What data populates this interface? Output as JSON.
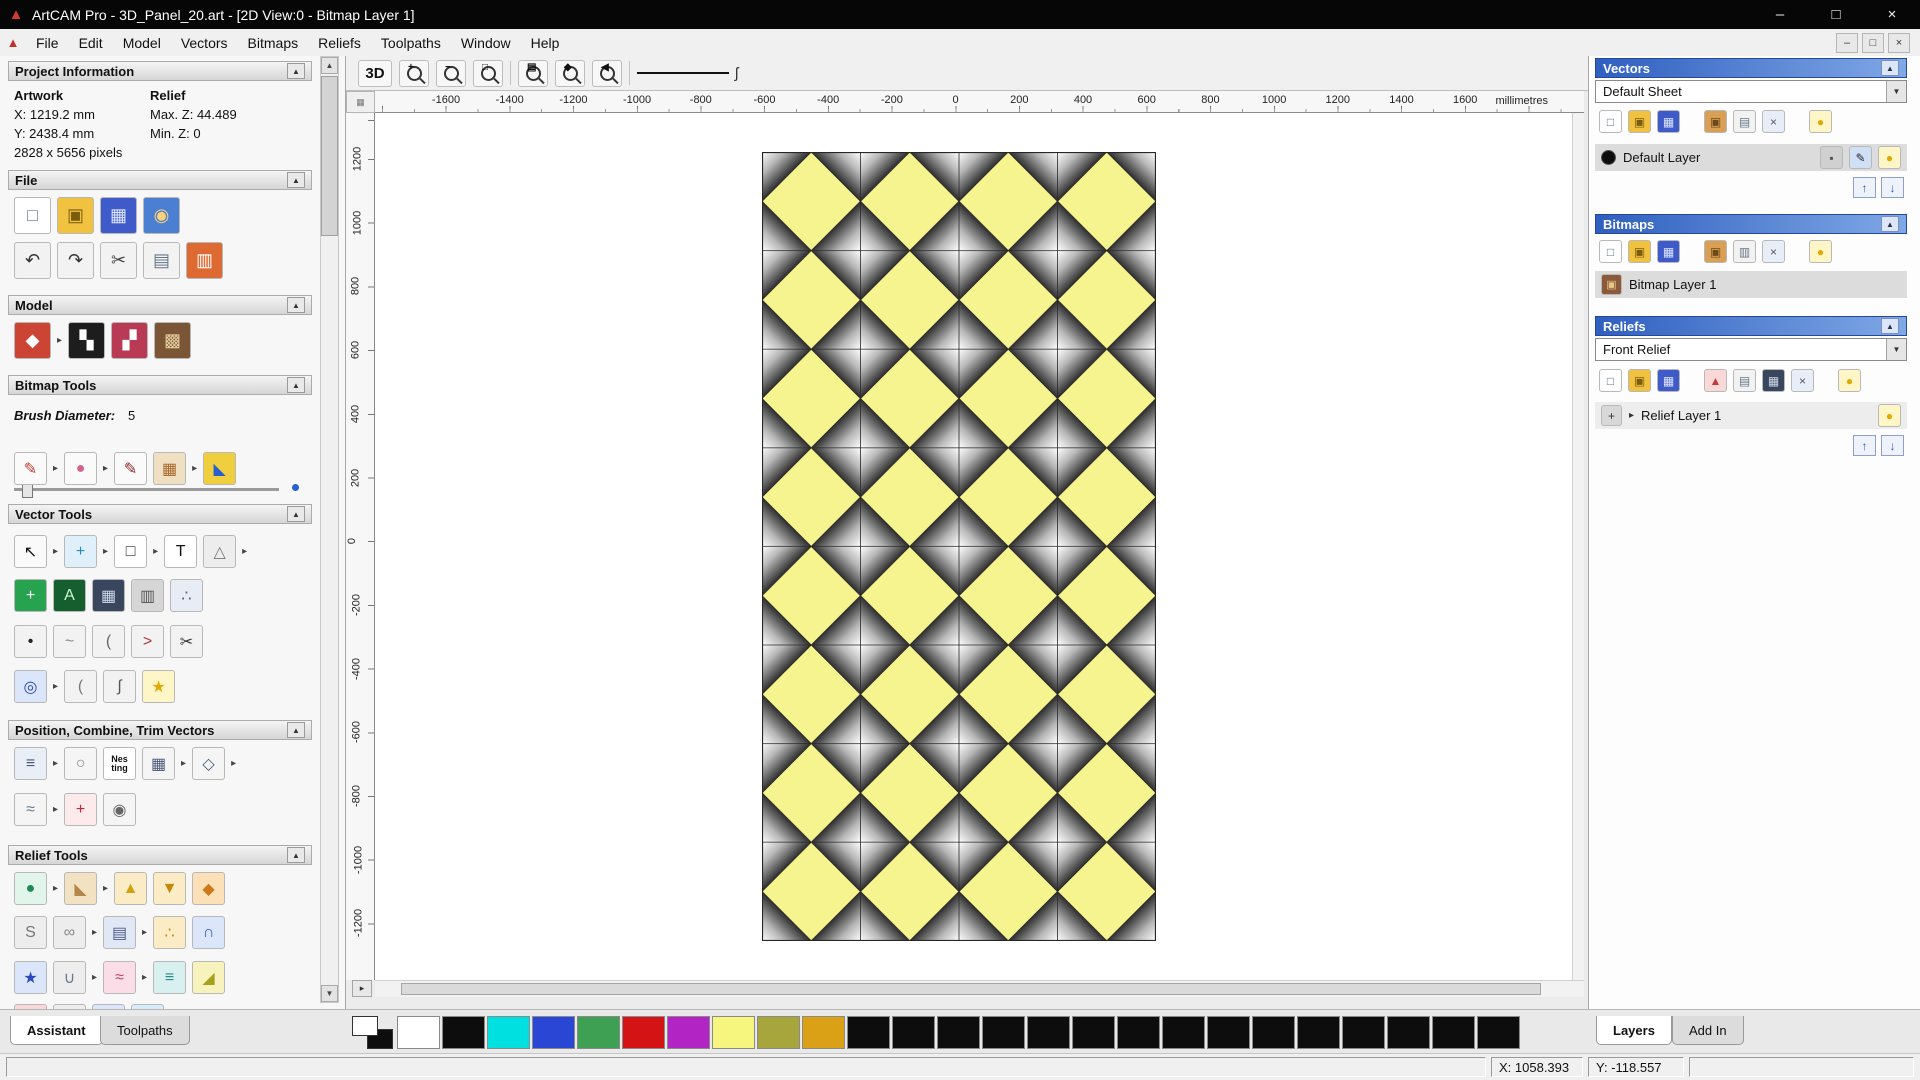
{
  "window": {
    "title": "ArtCAM Pro - 3D_Panel_20.art - [2D View:0 - Bitmap Layer 1]",
    "minimize": "–",
    "maximize": "□",
    "close": "×"
  },
  "menu": {
    "items": [
      "File",
      "Edit",
      "Model",
      "Vectors",
      "Bitmaps",
      "Reliefs",
      "Toolpaths",
      "Window",
      "Help"
    ],
    "child_controls": [
      "–",
      "□",
      "×"
    ]
  },
  "left_panel": {
    "project_info": {
      "header": "Project Information",
      "artwork_label": "Artwork",
      "relief_label": "Relief",
      "artwork_x": "X: 1219.2 mm",
      "artwork_y": "Y: 2438.4 mm",
      "artwork_pixels": "2828 x 5656 pixels",
      "relief_max": "Max. Z: 44.489",
      "relief_min": "Min. Z: 0"
    },
    "file": {
      "header": "File",
      "row1": [
        {
          "n": "new-model",
          "g": "□",
          "bg": "#ffffff",
          "fg": "#667788"
        },
        {
          "n": "open-model",
          "g": "▣",
          "bg": "#f1c240",
          "fg": "#7a5c10"
        },
        {
          "n": "save-model",
          "g": "▦",
          "bg": "#3f5bc9",
          "fg": "#dfe6ff"
        },
        {
          "n": "model-preview",
          "g": "◉",
          "bg": "#4a7fd1",
          "fg": "#ffd27a"
        }
      ],
      "row2": [
        {
          "n": "undo",
          "g": "↶",
          "bg": "#f2f2f2",
          "fg": "#333333"
        },
        {
          "n": "redo",
          "g": "↷",
          "bg": "#f2f2f2",
          "fg": "#333333"
        },
        {
          "n": "cut",
          "g": "✂",
          "bg": "#f2f2f2",
          "fg": "#444444"
        },
        {
          "n": "copy",
          "g": "▤",
          "bg": "#f2f2f2",
          "fg": "#667788"
        },
        {
          "n": "paste",
          "g": "▥",
          "bg": "#dd6a33",
          "fg": "#ffffff"
        }
      ]
    },
    "model": {
      "header": "Model",
      "row": [
        {
          "n": "set-model-size",
          "g": "◆",
          "bg": "#cc4433",
          "fg": "#ffffff"
        },
        {
          "t": "fly"
        },
        {
          "n": "invert-model",
          "g": "▚",
          "bg": "#1d1d1d",
          "fg": "#ffffff"
        },
        {
          "n": "adjust-model",
          "g": "▞",
          "bg": "#b83a55",
          "fg": "#ffffff"
        },
        {
          "n": "load-bitmap",
          "g": "▩",
          "bg": "#7a5636",
          "fg": "#e6cf9e"
        }
      ]
    },
    "bitmap_tools": {
      "header": "Bitmap Tools",
      "brush_label": "Brush Diameter:",
      "brush_value": "5",
      "row": [
        {
          "n": "paint",
          "g": "✎",
          "bg": "#fafafa",
          "fg": "#c03a2b"
        },
        {
          "t": "fly"
        },
        {
          "n": "paint-selective",
          "g": "●",
          "bg": "#fafafa",
          "fg": "#d4628f"
        },
        {
          "t": "fly"
        },
        {
          "n": "draw",
          "g": "✎",
          "bg": "#fafafa",
          "fg": "#8a1f1f"
        },
        {
          "n": "colour-reduce",
          "g": "▦",
          "bg": "#efe0c2",
          "fg": "#a8652a"
        },
        {
          "t": "fly"
        },
        {
          "n": "flood-fill",
          "g": "◣",
          "bg": "#f0cf3e",
          "fg": "#2a5fd1"
        }
      ]
    },
    "vector_tools": {
      "header": "Vector Tools",
      "row1": [
        {
          "n": "select-vectors",
          "g": "↖",
          "bg": "#fafafa",
          "fg": "#111111"
        },
        {
          "t": "fly"
        },
        {
          "n": "transform-vectors",
          "g": "+",
          "bg": "#dff0fa",
          "fg": "#2589bd"
        },
        {
          "t": "fly"
        },
        {
          "n": "create-rectangle",
          "g": "□",
          "bg": "#ffffff",
          "fg": "#333333"
        },
        {
          "t": "fly"
        },
        {
          "n": "create-text",
          "g": "T",
          "bg": "#ffffff",
          "fg": "#111111"
        },
        {
          "n": "measure-tool",
          "g": "△",
          "bg": "#ededed",
          "fg": "#777777"
        },
        {
          "t": "fly"
        }
      ],
      "row2": [
        {
          "n": "snap-to-grid",
          "g": "+",
          "bg": "#27a24f",
          "fg": "#ffffff"
        },
        {
          "n": "text-on-curve",
          "g": "A",
          "bg": "#155e2e",
          "fg": "#c8f5d2"
        },
        {
          "n": "grid-settings",
          "g": "▦",
          "bg": "#39465e",
          "fg": "#cdd8ea"
        },
        {
          "n": "guidelines",
          "g": "▥",
          "bg": "#d6d6d6",
          "fg": "#555555"
        },
        {
          "n": "paste-along-curve",
          "g": "∴",
          "bg": "#e8ecf5",
          "fg": "#56607a"
        }
      ],
      "row3": [
        {
          "n": "node-editing",
          "g": "•",
          "bg": "#f2f2f2",
          "fg": "#222222"
        },
        {
          "n": "create-polyline",
          "g": "~",
          "bg": "#f2f2f2",
          "fg": "#888888"
        },
        {
          "n": "fit-arc",
          "g": "(",
          "bg": "#f2f2f2",
          "fg": "#666666"
        },
        {
          "n": "freehand-draw",
          "g": ">",
          "bg": "#f2f2f2",
          "fg": "#b03a3a"
        },
        {
          "n": "trim-vectors",
          "g": "✂",
          "bg": "#f2f2f2",
          "fg": "#333333"
        }
      ],
      "row4": [
        {
          "n": "offset-vectors",
          "g": "◎",
          "bg": "#dbe6fa",
          "fg": "#2a49bd"
        },
        {
          "t": "fly"
        },
        {
          "n": "fillet-corners",
          "g": "(",
          "bg": "#f2f2f2",
          "fg": "#777777"
        },
        {
          "n": "create-section",
          "g": "∫",
          "bg": "#f2f2f2",
          "fg": "#555555"
        },
        {
          "n": "create-star",
          "g": "★",
          "bg": "#fff6c8",
          "fg": "#e0a800"
        }
      ]
    },
    "position_tools": {
      "header": "Position, Combine, Trim Vectors",
      "row1": [
        {
          "n": "align-vectors",
          "g": "≡",
          "bg": "#e9eff7",
          "fg": "#4a5a7a"
        },
        {
          "t": "fly"
        },
        {
          "n": "circular-copy",
          "g": "○",
          "bg": "#f5f5f5",
          "fg": "#888888"
        },
        {
          "n": "nesting",
          "g": "Nes ting",
          "bg": "#ffffff",
          "fg": "#111111"
        },
        {
          "n": "block-copy",
          "g": "▦",
          "bg": "#f5f5f5",
          "fg": "#4a5a7a"
        },
        {
          "t": "fly"
        },
        {
          "n": "copy-rotate",
          "g": "◇",
          "bg": "#f5f5f5",
          "fg": "#4a5a7a"
        },
        {
          "t": "fly"
        }
      ],
      "row2": [
        {
          "n": "mirror-vectors",
          "g": "≈",
          "bg": "#f5f5f5",
          "fg": "#6a7a8a"
        },
        {
          "t": "fly"
        },
        {
          "n": "vector-doctor",
          "g": "+",
          "bg": "#fdeaea",
          "fg": "#c22a3a"
        },
        {
          "n": "create-spiral",
          "g": "◉",
          "bg": "#f5f5f5",
          "fg": "#666666"
        }
      ]
    },
    "relief_tools": {
      "header": "Relief Tools",
      "row1": [
        {
          "n": "shape-editor",
          "g": "●",
          "bg": "#e2f5ea",
          "fg": "#1f8a55"
        },
        {
          "t": "fly"
        },
        {
          "n": "smooth-relief",
          "g": "◣",
          "bg": "#f2e2c2",
          "fg": "#b5854a"
        },
        {
          "t": "fly"
        },
        {
          "n": "add-relief",
          "g": "▲",
          "bg": "#fcecc5",
          "fg": "#d2a012"
        },
        {
          "n": "subtract-relief",
          "g": "▼",
          "bg": "#fcecc5",
          "fg": "#c28a0a"
        },
        {
          "n": "dynamic-relief",
          "g": "◆",
          "bg": "#fbe0b8",
          "fg": "#cc7a1a"
        }
      ],
      "row2": [
        {
          "n": "sculpt",
          "g": "S",
          "bg": "#ededed",
          "fg": "#777777"
        },
        {
          "n": "weave-wizard",
          "g": "∞",
          "bg": "#ededed",
          "fg": "#888888"
        },
        {
          "t": "fly"
        },
        {
          "n": "emboss-relief",
          "g": "▤",
          "bg": "#e0e8f5",
          "fg": "#4a5a8a"
        },
        {
          "t": "fly"
        },
        {
          "n": "texture-relief",
          "g": "∴",
          "bg": "#fcecc5",
          "fg": "#c28a0a"
        },
        {
          "n": "constant-height",
          "g": "∩",
          "bg": "#dbe6fa",
          "fg": "#3a5acc"
        }
      ],
      "row3": [
        {
          "n": "star-wizard",
          "g": "★",
          "bg": "#dbe6fa",
          "fg": "#2a49bd"
        },
        {
          "n": "envelope-distort",
          "g": "∪",
          "bg": "#ededed",
          "fg": "#6a7a8a"
        },
        {
          "t": "fly"
        },
        {
          "n": "two-rail-sweep",
          "g": "≈",
          "bg": "#fbdde7",
          "fg": "#c2406a"
        },
        {
          "t": "fly"
        },
        {
          "n": "extrude-relief",
          "g": "≡",
          "bg": "#d8f0f0",
          "fg": "#2a8a8a"
        },
        {
          "n": "angled-plane",
          "g": "◢",
          "bg": "#f8f3bd",
          "fg": "#a8a020"
        }
      ],
      "row4": [
        {
          "n": "turn-relief",
          "g": "●",
          "bg": "#fbd8d8",
          "fg": "#c23a3a"
        },
        {
          "n": "mesh-creator",
          "g": "▦",
          "bg": "#ededed",
          "fg": "#666666"
        },
        {
          "n": "face-wizard",
          "g": "◉",
          "bg": "#dbe6fa",
          "fg": "#2a49bd"
        },
        {
          "n": "texture-flow",
          "g": "@",
          "bg": "#d8ecfb",
          "fg": "#2a6fbd"
        }
      ]
    },
    "tabs": {
      "assistant": "Assistant",
      "toolpaths": "Toolpaths"
    }
  },
  "canvas": {
    "toolbar": {
      "view3d": "3D"
    },
    "ruler": {
      "h_labels": [
        "-1600",
        "-1400",
        "-1200",
        "-1000",
        "-800",
        "-600",
        "-400",
        "-200",
        "0",
        "200",
        "400",
        "600",
        "800",
        "1000",
        "1200",
        "1400",
        "1600"
      ],
      "v_labels": [
        "1200",
        "1000",
        "800",
        "600",
        "400",
        "200",
        "0",
        "-200",
        "-400",
        "-600",
        "-800",
        "-1000",
        "-1200"
      ],
      "unit": "millimetres"
    }
  },
  "right_panel": {
    "vectors": {
      "header": "Vectors",
      "sheet": "Default Sheet",
      "toolbar": [
        {
          "n": "new-sheet",
          "g": "□",
          "bg": "#ffffff",
          "fg": "#667788"
        },
        {
          "n": "open-vectors",
          "g": "▣",
          "bg": "#f1c240",
          "fg": "#7a5c10"
        },
        {
          "n": "save-vectors",
          "g": "▦",
          "bg": "#3f5bc9",
          "fg": "#dfe6ff"
        },
        {
          "t": "gap"
        },
        {
          "n": "import-vectors",
          "g": "▣",
          "bg": "#d9a055",
          "fg": "#6d4a1a"
        },
        {
          "n": "copy-vectors",
          "g": "▤",
          "bg": "#f2f2f2",
          "fg": "#667788"
        },
        {
          "n": "delete-vector-layer",
          "g": "×",
          "bg": "#e8eef8",
          "fg": "#555566"
        },
        {
          "t": "gap"
        },
        {
          "n": "toggle-all-vectors",
          "g": "●",
          "bg": "#fff6c8",
          "fg": "#e0a800"
        }
      ],
      "layer": {
        "label": "Default Layer",
        "swatch": "#0d0d0d",
        "icons": [
          {
            "n": "lock-layer",
            "g": "▪",
            "bg": "#d0d0d0",
            "fg": "#555555"
          },
          {
            "n": "edit-layer",
            "g": "✎",
            "bg": "#cfe0f5",
            "fg": "#222233"
          },
          {
            "n": "layer-visibility",
            "g": "●",
            "bg": "#fff6c8",
            "fg": "#e0a800"
          }
        ]
      },
      "up": "↑",
      "down": "↓"
    },
    "bitmaps": {
      "header": "Bitmaps",
      "toolbar": [
        {
          "n": "new-bitmap-layer",
          "g": "□",
          "bg": "#ffffff",
          "fg": "#667788"
        },
        {
          "n": "open-bitmap",
          "g": "▣",
          "bg": "#f1c240",
          "fg": "#7a5c10"
        },
        {
          "n": "save-bitmap",
          "g": "▦",
          "bg": "#3f5bc9",
          "fg": "#dfe6ff"
        },
        {
          "t": "gap"
        },
        {
          "n": "import-bitmap",
          "g": "▣",
          "bg": "#d9a055",
          "fg": "#6d4a1a"
        },
        {
          "n": "merge-bitmap",
          "g": "▥",
          "bg": "#f2f2f2",
          "fg": "#667788"
        },
        {
          "n": "delete-bitmap-layer",
          "g": "×",
          "bg": "#e8eef8",
          "fg": "#555566"
        },
        {
          "t": "gap"
        },
        {
          "n": "toggle-all-bitmaps",
          "g": "●",
          "bg": "#fff6c8",
          "fg": "#e0a800"
        }
      ],
      "layer": {
        "label": "Bitmap Layer 1",
        "thumb": {
          "n": "bitmap-thumbnail",
          "g": "▣",
          "bg": "#8a5a3a",
          "fg": "#e8c888"
        }
      }
    },
    "reliefs": {
      "header": "Reliefs",
      "relief": "Front Relief",
      "toolbar": [
        {
          "n": "new-relief-layer",
          "g": "□",
          "bg": "#ffffff",
          "fg": "#667788"
        },
        {
          "n": "open-relief",
          "g": "▣",
          "bg": "#f1c240",
          "fg": "#7a5c10"
        },
        {
          "n": "save-relief",
          "g": "▦",
          "bg": "#3f5bc9",
          "fg": "#dfe6ff"
        },
        {
          "t": "gap"
        },
        {
          "n": "import-relief",
          "g": "▲",
          "bg": "#fbd8d8",
          "fg": "#c23a3a"
        },
        {
          "n": "duplicate-relief",
          "g": "▤",
          "bg": "#f2f2f2",
          "fg": "#667788"
        },
        {
          "n": "relief-grid",
          "g": "▦",
          "bg": "#39465e",
          "fg": "#cdd8ea"
        },
        {
          "n": "delete-relief-layer",
          "g": "×",
          "bg": "#e8eef8",
          "fg": "#555566"
        },
        {
          "t": "gap"
        },
        {
          "n": "toggle-all-reliefs",
          "g": "●",
          "bg": "#fff6c8",
          "fg": "#e0a800"
        }
      ],
      "layer": {
        "label": "Relief Layer 1",
        "thumb": {
          "n": "relief-thumbnail",
          "g": "+",
          "bg": "#d8d8d8",
          "fg": "#333333"
        },
        "expander": "▸",
        "icons": [
          {
            "n": "relief-visibility",
            "g": "●",
            "bg": "#fff6c8",
            "fg": "#e0a800"
          }
        ]
      },
      "up": "↑",
      "down": "↓"
    },
    "tabs": {
      "layers": "Layers",
      "addin": "Add In"
    }
  },
  "palette": {
    "colors": [
      "multi",
      "#ffffff",
      "#0d0d0d",
      "#00e0e0",
      "#2a46d4",
      "#3da052",
      "#d41414",
      "#b224c4",
      "#f6f67e",
      "#a6a63c",
      "#daa016",
      "#0d0d0d",
      "#0d0d0d",
      "#0d0d0d",
      "#0d0d0d",
      "#0d0d0d",
      "#0d0d0d",
      "#0d0d0d",
      "#0d0d0d",
      "#0d0d0d",
      "#0d0d0d",
      "#0d0d0d",
      "#0d0d0d",
      "#0d0d0d",
      "#0d0d0d",
      "#0d0d0d"
    ]
  },
  "status": {
    "x": "X: 1058.393",
    "y": "Y: -118.557"
  },
  "artwork": {
    "yellow": "#f6f48e",
    "facet_light": "#ffffff",
    "facet_mid": "#b8b8b8",
    "facet_dark": "#2f2f2f",
    "outline": "#262626",
    "grid_cols": 8,
    "grid_rows": 16
  }
}
